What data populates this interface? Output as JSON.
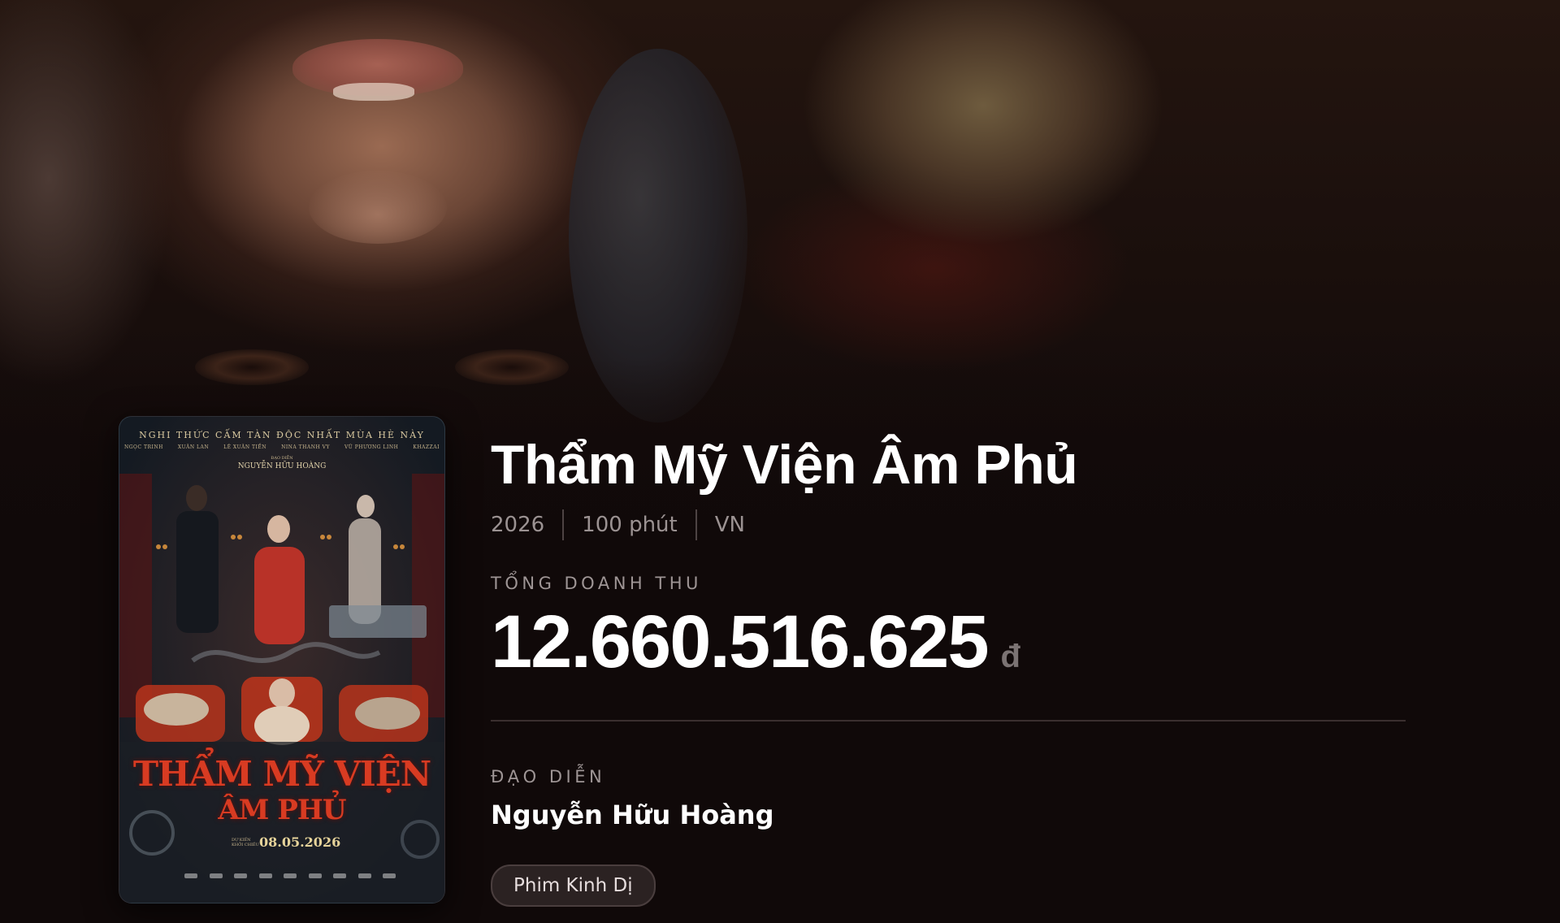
{
  "movie": {
    "title": "Thẩm Mỹ Viện Âm Phủ",
    "year": "2026",
    "duration": "100 phút",
    "country": "VN",
    "revenue_label": "TỔNG DOANH THU",
    "revenue_value": "12.660.516.625",
    "revenue_currency": "đ",
    "director_label": "ĐẠO DIỄN",
    "director_name": "Nguyễn Hữu Hoàng",
    "genres": [
      "Phim Kinh Dị"
    ]
  },
  "poster": {
    "tagline": "NGHI THỨC CẤM TÀN ĐỘC NHẤT MÙA HÈ NÀY",
    "cast": [
      "NGỌC TRINH",
      "XUÂN LAN",
      "LÊ XUÂN TIỀN",
      "NINA THANH VY",
      "VŨ PHƯƠNG LINH",
      "KHAZZAI"
    ],
    "director_label": "ĐẠO DIỄN",
    "director": "NGUYỄN HỮU HOÀNG",
    "title_line1": "THẨM MỸ VIỆN",
    "title_line2": "ÂM PHỦ",
    "date_label": "DỰ KIẾN KHỞI CHIẾU",
    "release_date": "08.05.2026"
  }
}
